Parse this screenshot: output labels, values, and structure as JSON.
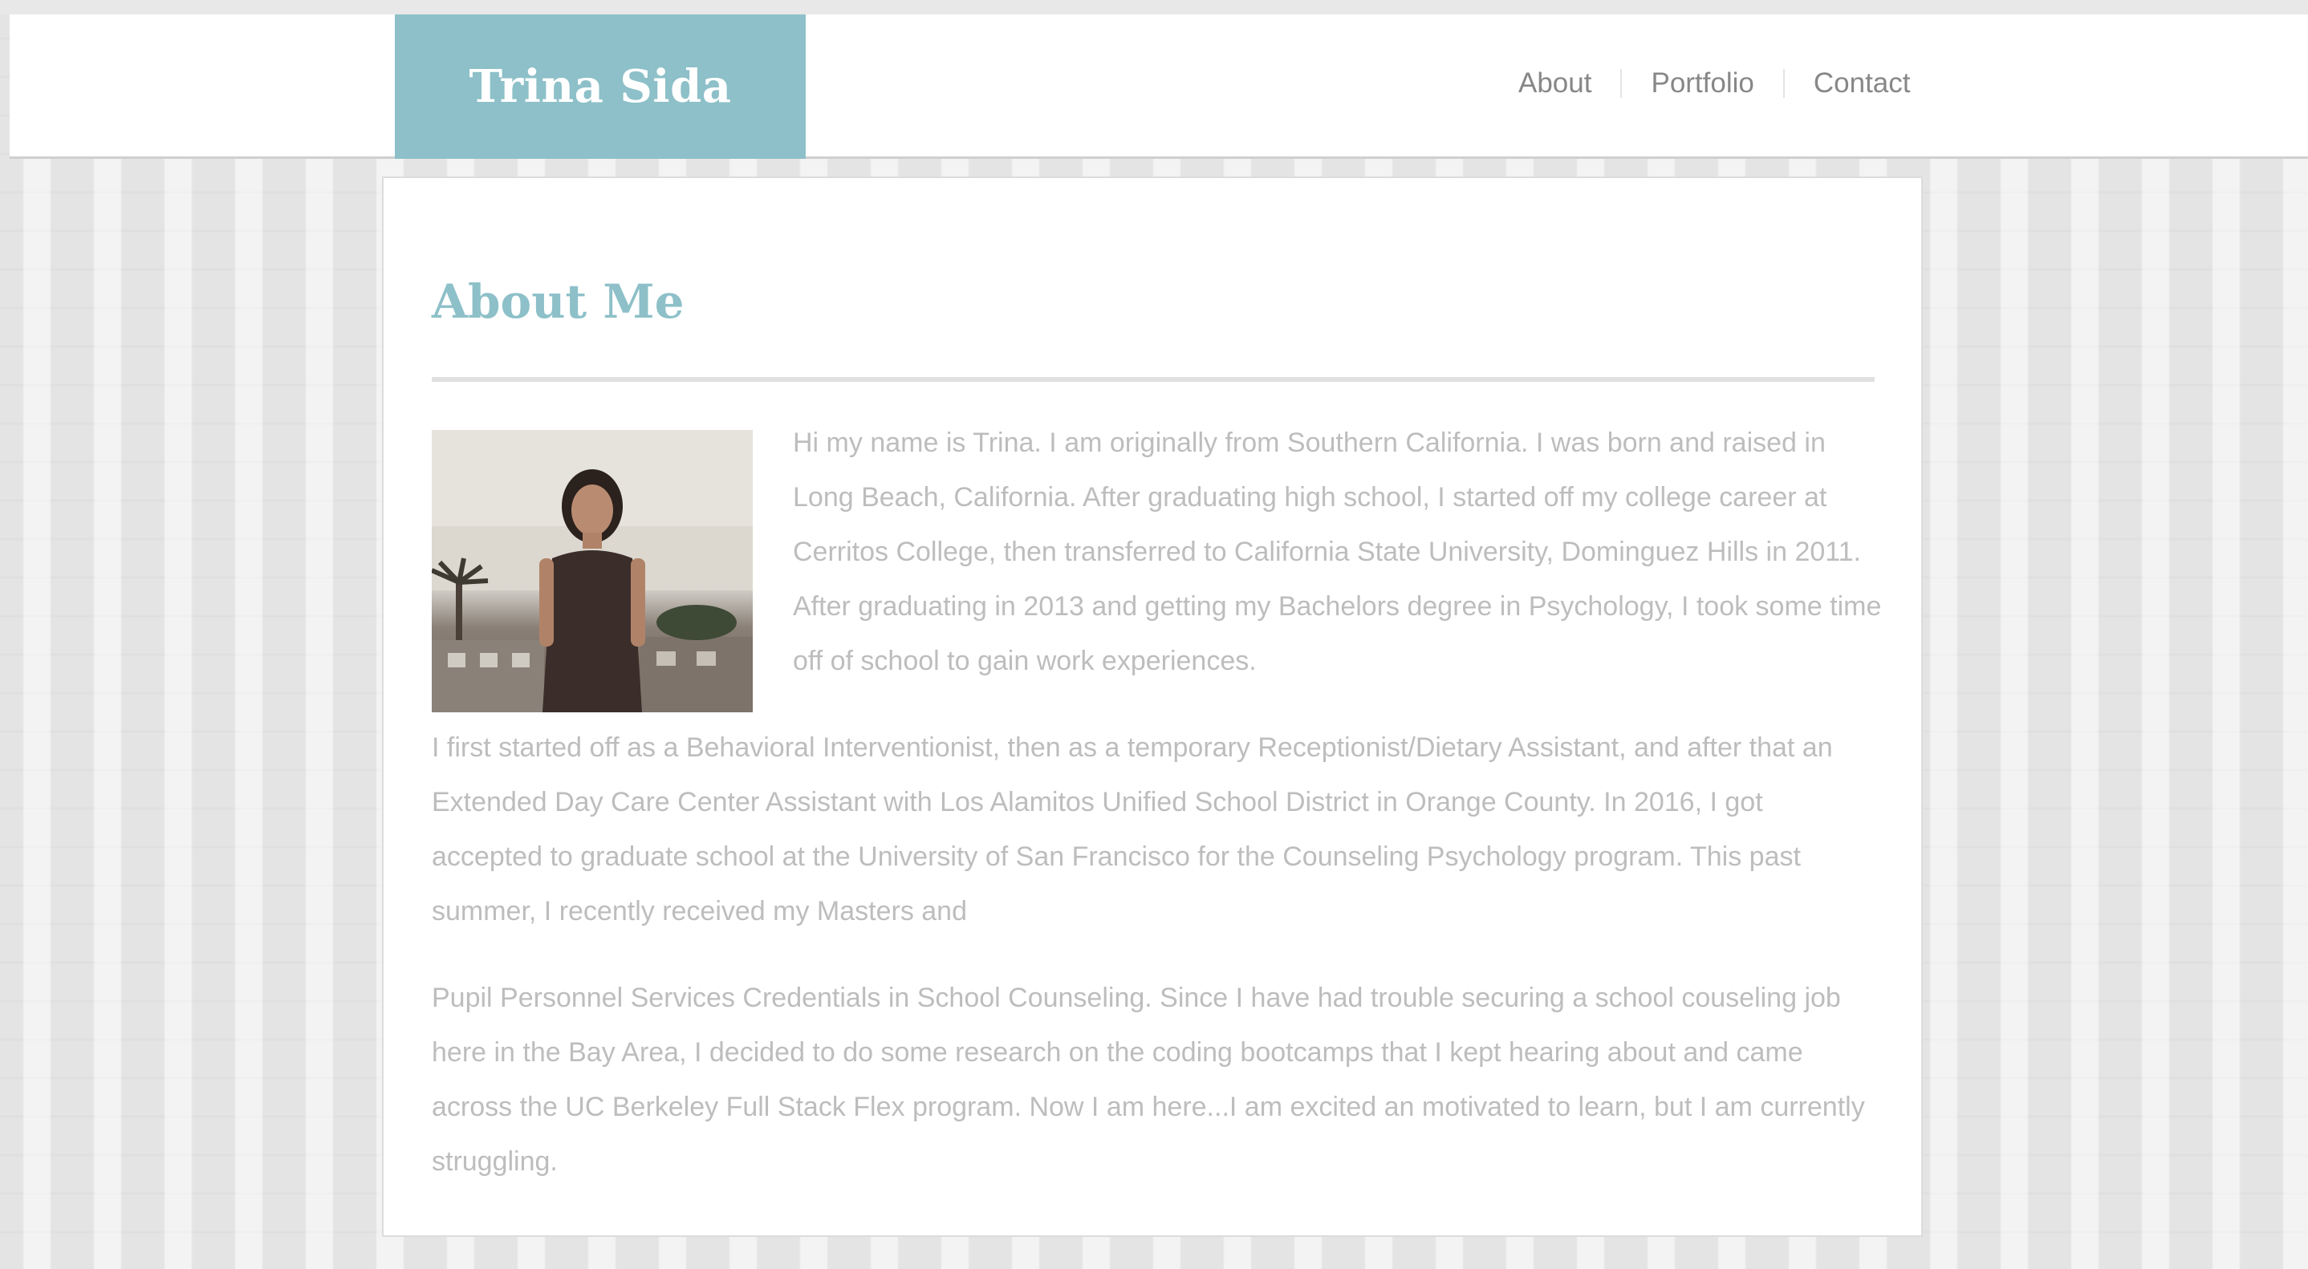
{
  "header": {
    "brand_name": "Trina Sida",
    "nav": [
      {
        "label": "About"
      },
      {
        "label": "Portfolio"
      },
      {
        "label": "Contact"
      }
    ]
  },
  "main": {
    "heading": "About Me",
    "photo_alt": "Photo of Trina",
    "paragraphs": [
      "Hi my name is Trina. I am originally from Southern California. I was born and raised in Long Beach, California. After graduating high school, I started off my college career at Cerritos College, then transferred to California State University, Dominguez Hills in 2011. After graduating in 2013 and getting my Bachelors degree in Psychology, I took some time off of school to gain work experiences.",
      "I first started off as a Behavioral Interventionist, then as a temporary Receptionist/Dietary Assistant, and after that an Extended Day Care Center Assistant with Los Alamitos Unified School District in Orange County. In 2016, I got accepted to graduate school at the University of San Francisco for the Counseling Psychology program. This past summer, I recently received my Masters and",
      "Pupil Personnel Services Credentials in School Counseling. Since I have had trouble securing a school couseling job here in the Bay Area, I decided to do some research on the coding bootcamps that I kept hearing about and came across the UC Berkeley Full Stack Flex program. Now I am here...I am excited an motivated to learn, but I am currently struggling."
    ]
  },
  "colors": {
    "accent": "#8dc0c8",
    "text_muted": "#bdbdbd",
    "nav_text": "#878787",
    "background": "#e4e4e4"
  }
}
